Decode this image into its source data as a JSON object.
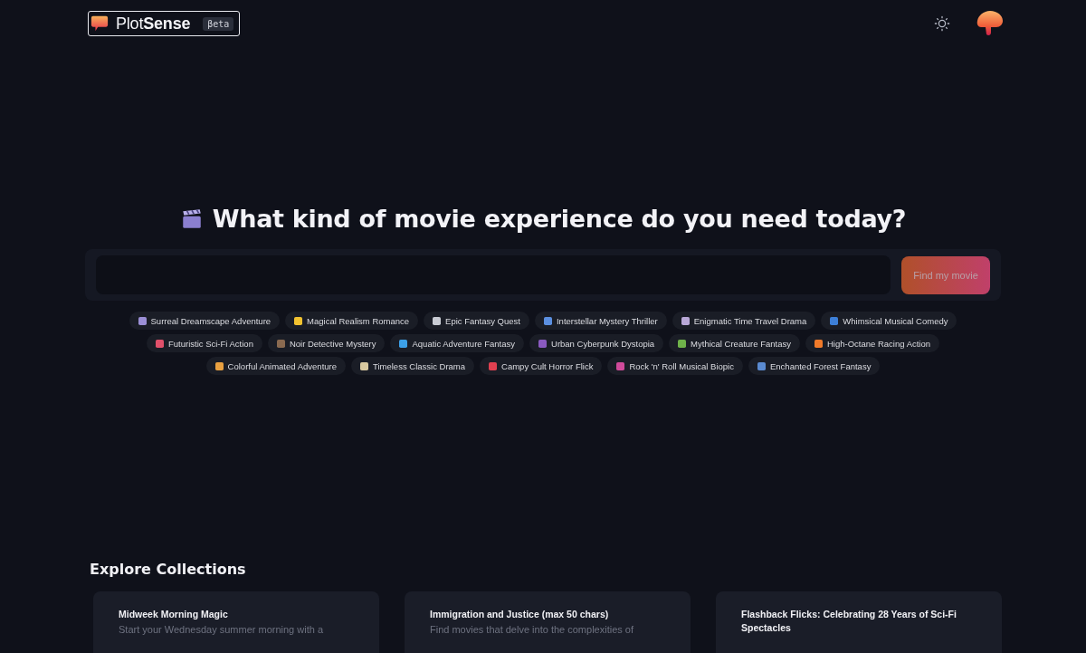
{
  "header": {
    "logo": {
      "name_light": "Plot",
      "name_bold": "Sense",
      "badge": "βeta"
    }
  },
  "hero": {
    "title": "What kind of movie experience do you need today?",
    "search": {
      "button": "Find my movie"
    },
    "suggestions": [
      {
        "label": "Surreal Dreamscape Adventure",
        "color": "#9b8fd6"
      },
      {
        "label": "Magical Realism Romance",
        "color": "#f2c230"
      },
      {
        "label": "Epic Fantasy Quest",
        "color": "#c9ccd4"
      },
      {
        "label": "Interstellar Mystery Thriller",
        "color": "#5b8fe0"
      },
      {
        "label": "Enigmatic Time Travel Drama",
        "color": "#b9a8d8"
      },
      {
        "label": "Whimsical Musical Comedy",
        "color": "#3d7fd8"
      },
      {
        "label": "Futuristic Sci-Fi Action",
        "color": "#e0506a"
      },
      {
        "label": "Noir Detective Mystery",
        "color": "#8a6a50"
      },
      {
        "label": "Aquatic Adventure Fantasy",
        "color": "#3ca0e8"
      },
      {
        "label": "Urban Cyberpunk Dystopia",
        "color": "#8a5ac0"
      },
      {
        "label": "Mythical Creature Fantasy",
        "color": "#6fb24a"
      },
      {
        "label": "High-Octane Racing Action",
        "color": "#f07a2a"
      },
      {
        "label": "Colorful Animated Adventure",
        "color": "#e8a040"
      },
      {
        "label": "Timeless Classic Drama",
        "color": "#d9c9a0"
      },
      {
        "label": "Campy Cult Horror Flick",
        "color": "#e04050"
      },
      {
        "label": "Rock 'n' Roll Musical Biopic",
        "color": "#d04a9a"
      },
      {
        "label": "Enchanted Forest Fantasy",
        "color": "#5a8ad0"
      }
    ]
  },
  "collections": {
    "title": "Explore Collections",
    "cards": [
      {
        "title": "Midweek Morning Magic",
        "description": "Start your Wednesday summer morning with a"
      },
      {
        "title": "Immigration and Justice (max 50 chars)",
        "description": "Find movies that delve into the complexities of"
      },
      {
        "title": "Flashback Flicks: Celebrating 28 Years of Sci-Fi Spectacles"
      }
    ]
  }
}
